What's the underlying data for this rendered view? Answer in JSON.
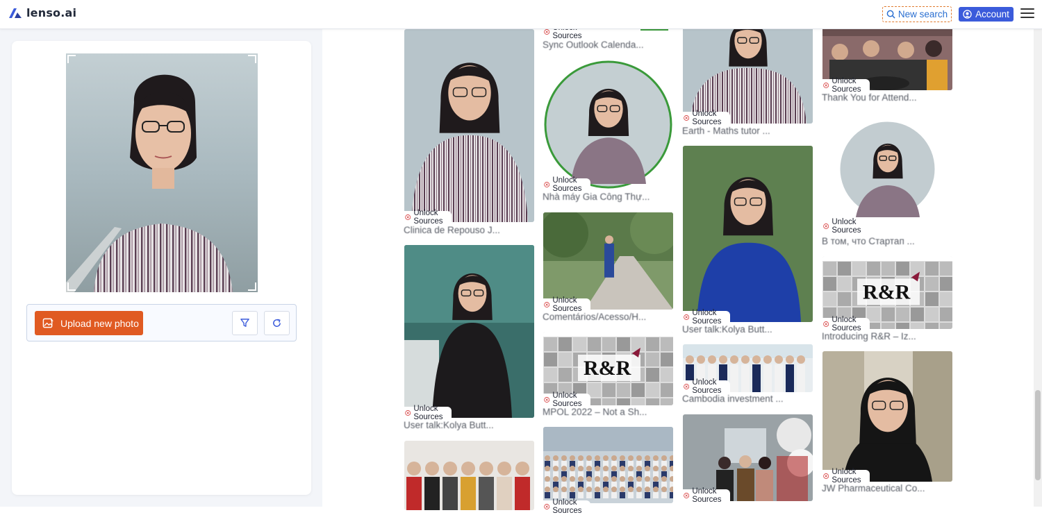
{
  "brand": {
    "name": "lenso.ai",
    "accent": "#3b5bdb",
    "upload_color": "#e05a22"
  },
  "header": {
    "new_search_label": "New search",
    "account_label": "Account",
    "search_icon": "search-icon",
    "account_icon": "account-icon",
    "menu_icon": "hamburger-menu-icon"
  },
  "left": {
    "upload_label": "Upload new photo",
    "upload_icon": "image-edit-icon",
    "filter_icon": "filter-icon",
    "refresh_icon": "refresh-icon"
  },
  "badge_label": "Unlock Sources",
  "results": [
    {
      "title": "Sync Outlook Calenda..."
    },
    {
      "title": "Earth - Maths tutor ..."
    },
    {
      "title": "Thank You for Attend..."
    },
    {
      "title": "Clinica de Repouso J..."
    },
    {
      "title": "Nhà máy Gia Công Thự..."
    },
    {
      "title": "В том, что Стартап ..."
    },
    {
      "title": "Comentários/Acesso/H..."
    },
    {
      "title": "User talk:Kolya Butt..."
    },
    {
      "title": "Introducing R&R – Iz..."
    },
    {
      "title": "User talk:Kolya Butt..."
    },
    {
      "title": "MPOL 2022 – Not a Sh..."
    },
    {
      "title": "Cambodia investment ..."
    },
    {
      "title": "JW Pharmaceutical Co..."
    },
    {
      "title": ""
    },
    {
      "title": ""
    },
    {
      "title": ""
    }
  ]
}
